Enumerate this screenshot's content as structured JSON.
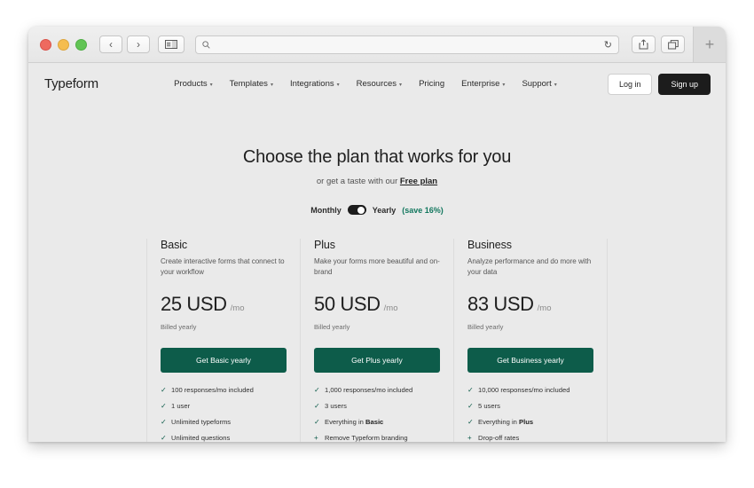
{
  "browser": {
    "traffic_lights": [
      "close",
      "minimize",
      "zoom"
    ],
    "back_icon": "‹",
    "forward_icon": "›",
    "sidebar_icon": "sidebar",
    "search_icon": "search",
    "reload_icon": "↻",
    "share_icon": "share",
    "tabs_icon": "tab-overview",
    "newtab_icon": "+",
    "address_value": "",
    "address_placeholder": ""
  },
  "site": {
    "logo": "Typeform",
    "nav": [
      {
        "label": "Products",
        "has_caret": true
      },
      {
        "label": "Templates",
        "has_caret": true
      },
      {
        "label": "Integrations",
        "has_caret": true
      },
      {
        "label": "Resources",
        "has_caret": true
      },
      {
        "label": "Pricing",
        "has_caret": false
      },
      {
        "label": "Enterprise",
        "has_caret": true
      },
      {
        "label": "Support",
        "has_caret": true
      }
    ],
    "caret_glyph": "▾",
    "login_label": "Log in",
    "signup_label": "Sign up"
  },
  "hero": {
    "title": "Choose the plan that works for you",
    "subtitle_prefix": "or get a taste with our ",
    "subtitle_link": "Free plan"
  },
  "billing_toggle": {
    "monthly_label": "Monthly",
    "yearly_label": "Yearly",
    "save_note": "(save 16%)",
    "selected": "Yearly"
  },
  "plans": [
    {
      "name": "Basic",
      "description": "Create interactive forms that connect to your workflow",
      "price": "25 USD",
      "period": "/mo",
      "billed": "Billed yearly",
      "cta": "Get Basic yearly",
      "features": [
        {
          "mark": "✓",
          "text": "100 responses/mo included"
        },
        {
          "mark": "✓",
          "text": "1 user"
        },
        {
          "mark": "✓",
          "text": "Unlimited typeforms"
        },
        {
          "mark": "✓",
          "text": "Unlimited questions"
        }
      ]
    },
    {
      "name": "Plus",
      "description": "Make your forms more beautiful and on-brand",
      "price": "50 USD",
      "period": "/mo",
      "billed": "Billed yearly",
      "cta": "Get Plus yearly",
      "features": [
        {
          "mark": "✓",
          "text": "1,000 responses/mo included"
        },
        {
          "mark": "✓",
          "text": "3 users"
        },
        {
          "mark": "✓",
          "text": "Everything in ",
          "bold": "Basic"
        },
        {
          "mark": "+",
          "text": "Remove Typeform branding"
        }
      ]
    },
    {
      "name": "Business",
      "description": "Analyze performance and do more with your data",
      "price": "83 USD",
      "period": "/mo",
      "billed": "Billed yearly",
      "cta": "Get Business yearly",
      "features": [
        {
          "mark": "✓",
          "text": "10,000 responses/mo included"
        },
        {
          "mark": "✓",
          "text": "5 users"
        },
        {
          "mark": "✓",
          "text": "Everything in ",
          "bold": "Plus"
        },
        {
          "mark": "+",
          "text": "Drop-off rates"
        }
      ]
    }
  ],
  "colors": {
    "brand_green": "#0d5c4a",
    "signup_black": "#1c1c1c",
    "page_bg": "#eaeaea"
  }
}
